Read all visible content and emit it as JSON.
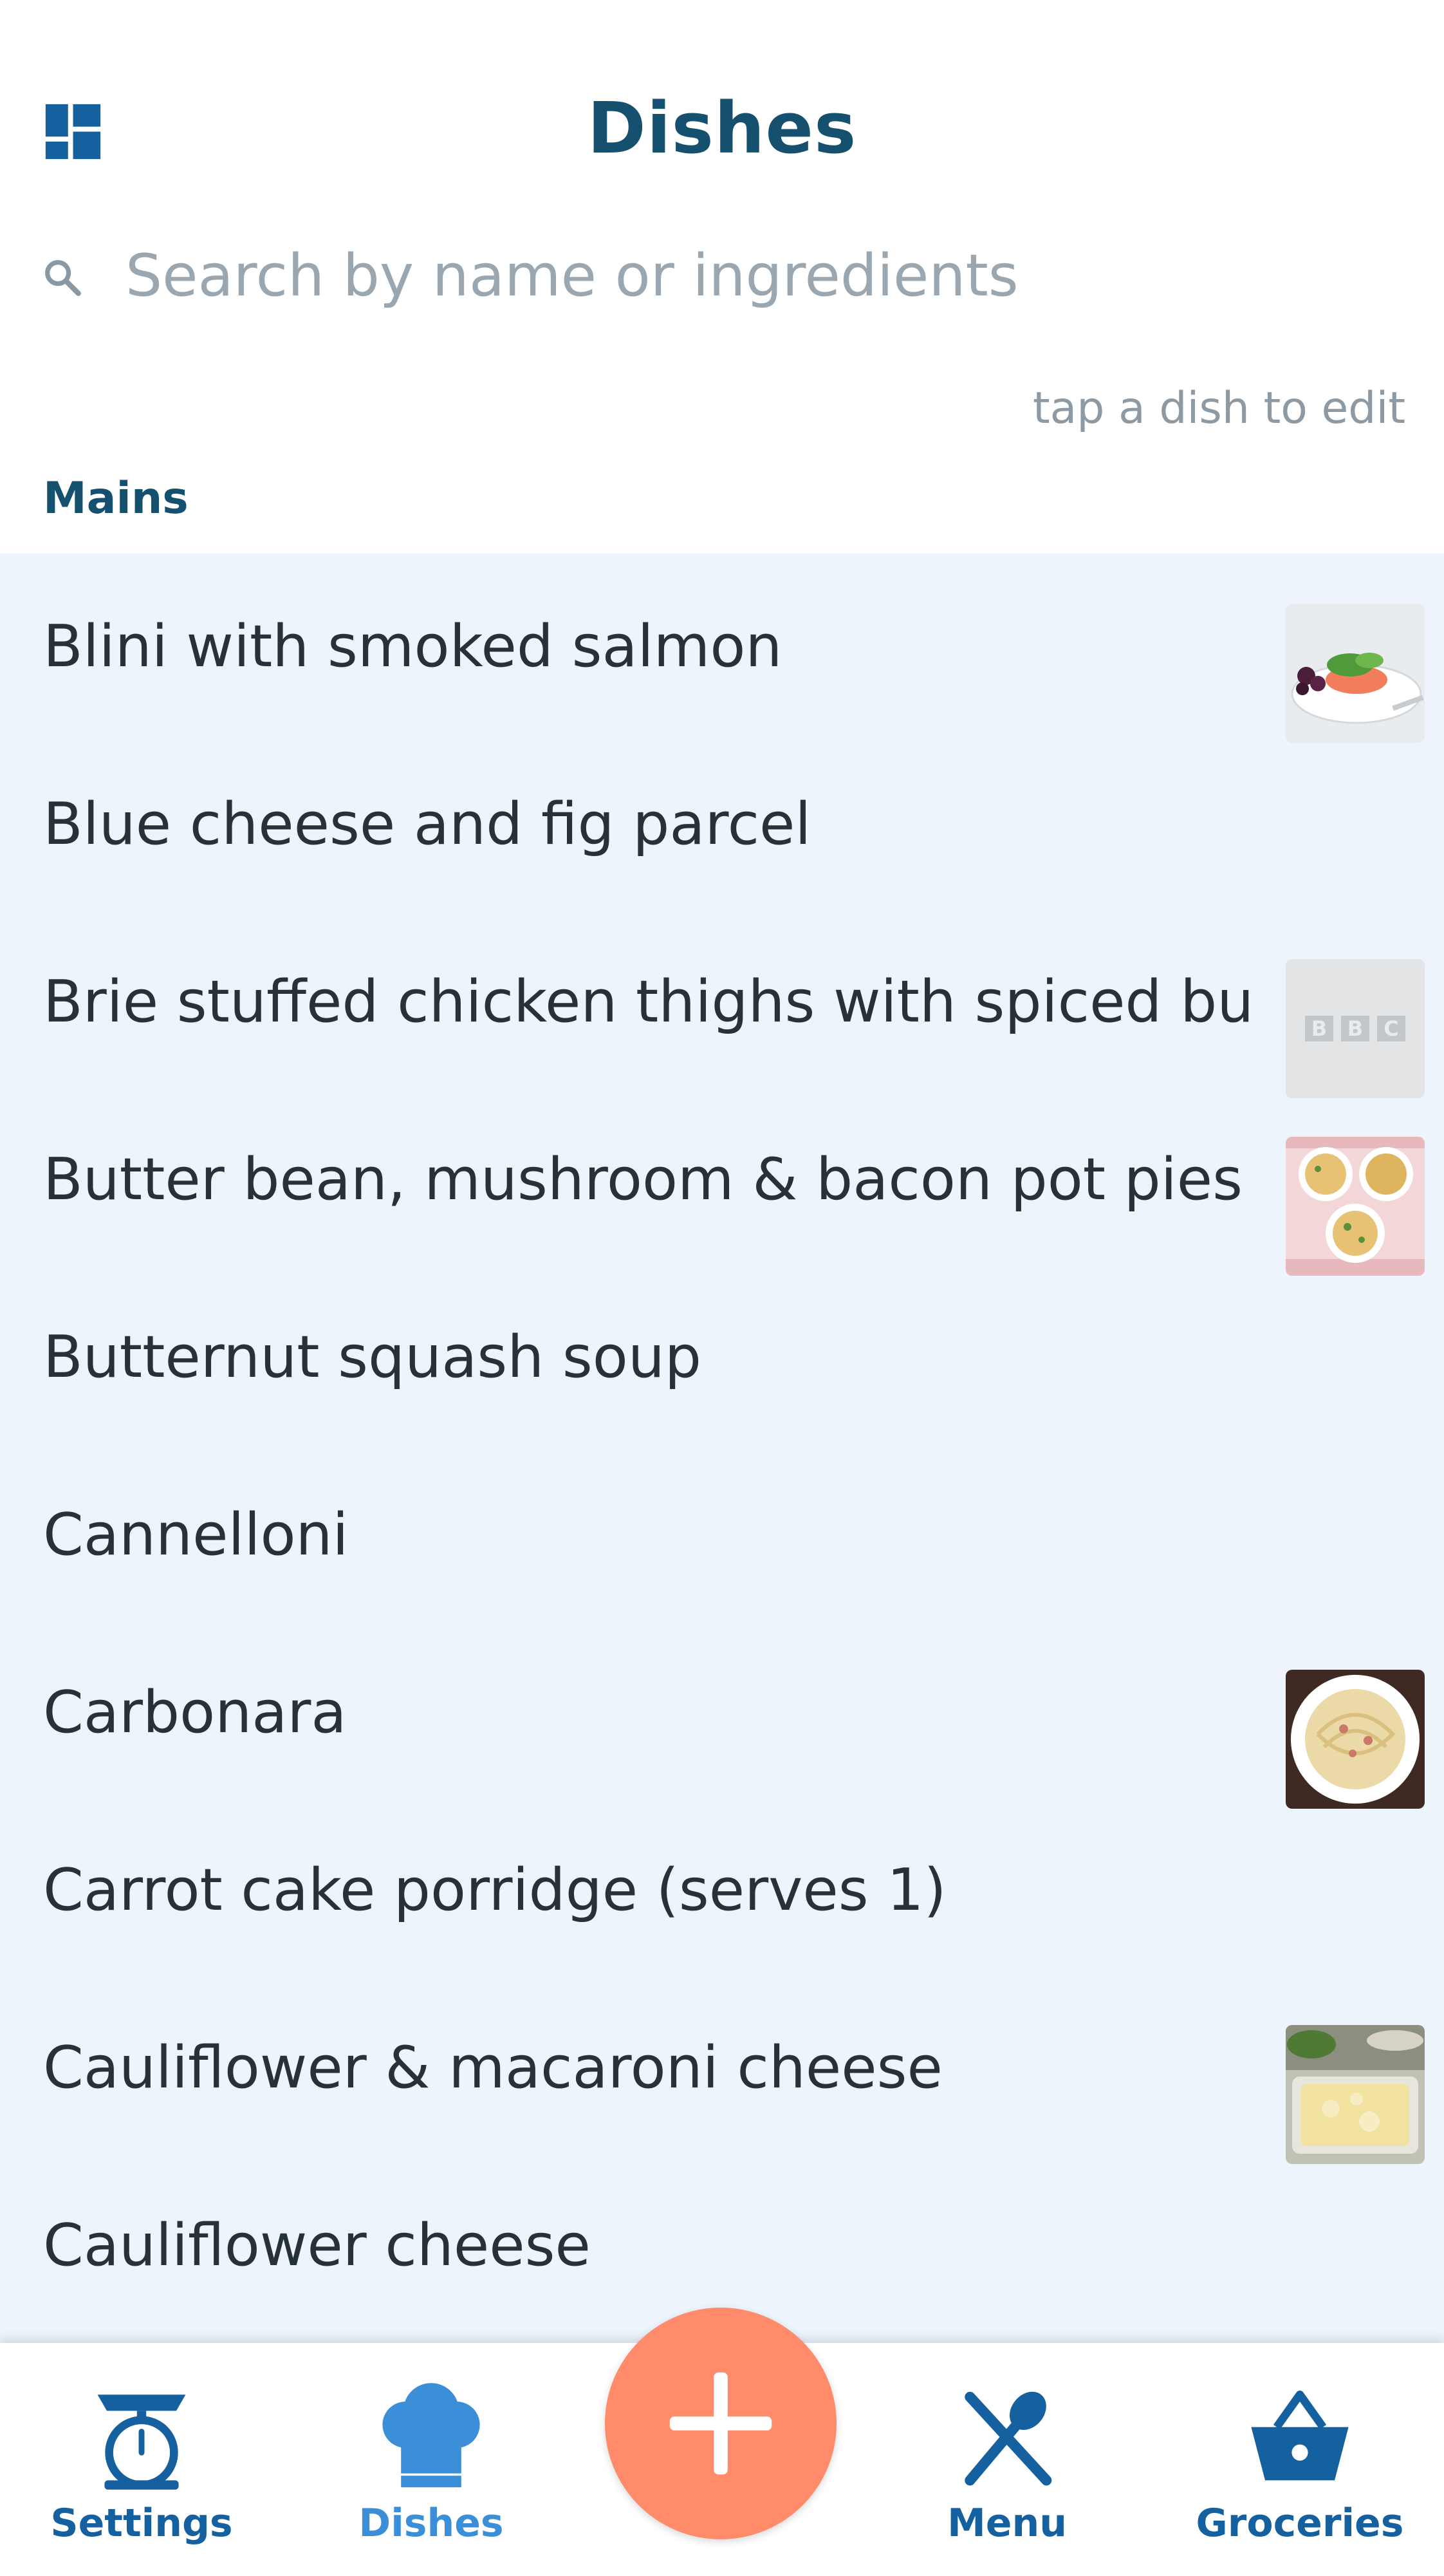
{
  "header": {
    "title": "Dishes",
    "layout_icon": "grid-layout-icon"
  },
  "search": {
    "placeholder": "Search by name or ingredients",
    "value": "",
    "icon": "search-icon"
  },
  "hint": "tap a dish to edit",
  "section": {
    "label": "Mains"
  },
  "dishes": [
    {
      "label": "Blini with smoked salmon",
      "thumbnail": "salmon-plate-photo"
    },
    {
      "label": "Blue cheese and fig parcel",
      "thumbnail": ""
    },
    {
      "label": "Brie stuffed chicken thighs with spiced butter",
      "thumbnail": "bbc-logo-placeholder"
    },
    {
      "label": "Butter bean, mushroom & bacon pot pies",
      "thumbnail": "pot-pies-photo"
    },
    {
      "label": "Butternut squash soup",
      "thumbnail": ""
    },
    {
      "label": "Cannelloni",
      "thumbnail": ""
    },
    {
      "label": "Carbonara",
      "thumbnail": "carbonara-photo"
    },
    {
      "label": "Carrot cake porridge (serves 1)",
      "thumbnail": ""
    },
    {
      "label": "Cauliflower & macaroni cheese",
      "thumbnail": "macaroni-cheese-photo"
    },
    {
      "label": "Cauliflower cheese",
      "thumbnail": ""
    }
  ],
  "bbc_logo_text": "BBC",
  "tabs": [
    {
      "label": "Settings",
      "icon": "kitchen-scale-icon",
      "active": false
    },
    {
      "label": "Dishes",
      "icon": "chef-hat-icon",
      "active": true
    },
    {
      "label": "Menu",
      "icon": "fork-spoon-icon",
      "active": false
    },
    {
      "label": "Groceries",
      "icon": "shopping-basket-icon",
      "active": false
    }
  ],
  "fab": {
    "icon": "plus-icon"
  },
  "colors": {
    "primary": "#15506f",
    "active_tab": "#3b8fd9",
    "list_background": "#edf4fc",
    "fab": "#ff8b6b"
  }
}
